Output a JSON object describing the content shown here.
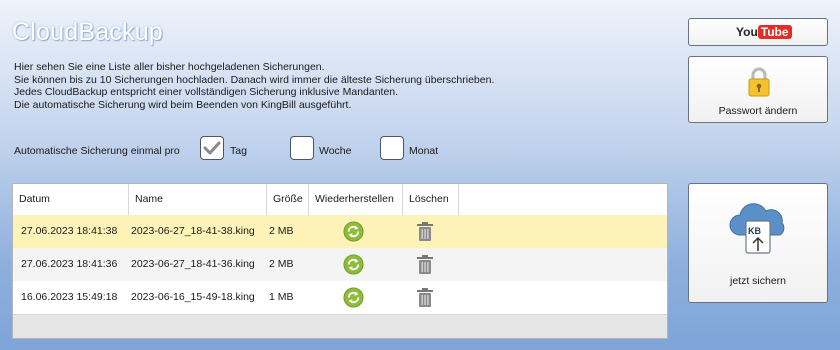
{
  "app": {
    "title": "CloudBackup"
  },
  "description": [
    "Hier sehen Sie eine Liste aller bisher hochgeladenen Sicherungen.",
    "Sie können bis zu 10 Sicherungen hochladen. Danach wird immer die älteste Sicherung überschrieben.",
    "Jedes CloudBackup entspricht einer vollständigen Sicherung inklusive Mandanten.",
    "Die automatische Sicherung wird beim Beenden von KingBill ausgeführt."
  ],
  "auto_backup": {
    "label": "Automatische Sicherung einmal pro",
    "options": [
      {
        "label": "Tag",
        "checked": true
      },
      {
        "label": "Woche",
        "checked": false
      },
      {
        "label": "Monat",
        "checked": false
      }
    ]
  },
  "table": {
    "columns": [
      "Datum",
      "Name",
      "Größe",
      "Wiederherstellen",
      "Löschen"
    ],
    "rows": [
      {
        "date": "27.06.2023 18:41:38",
        "name": "2023-06-27_18-41-38.king",
        "size": "2 MB",
        "selected": true
      },
      {
        "date": "27.06.2023 18:41:36",
        "name": "2023-06-27_18-41-36.king",
        "size": "2 MB",
        "selected": false
      },
      {
        "date": "16.06.2023 15:49:18",
        "name": "2023-06-16_15-49-18.king",
        "size": "1 MB",
        "selected": false
      }
    ]
  },
  "buttons": {
    "youtube_text_1": "You",
    "youtube_text_2": "Tube",
    "password_label": "Passwort ändern",
    "backup_label": "jetzt sichern",
    "cloud_badge": "KB"
  },
  "icons": {
    "password": "padlock-icon",
    "backup": "cloud-upload-icon",
    "restore": "restore-icon",
    "delete": "trash-icon"
  },
  "colors": {
    "selected_row": "#fdf3b8",
    "youtube_red": "#e52d27",
    "restore_green": "#8fbc3a"
  }
}
